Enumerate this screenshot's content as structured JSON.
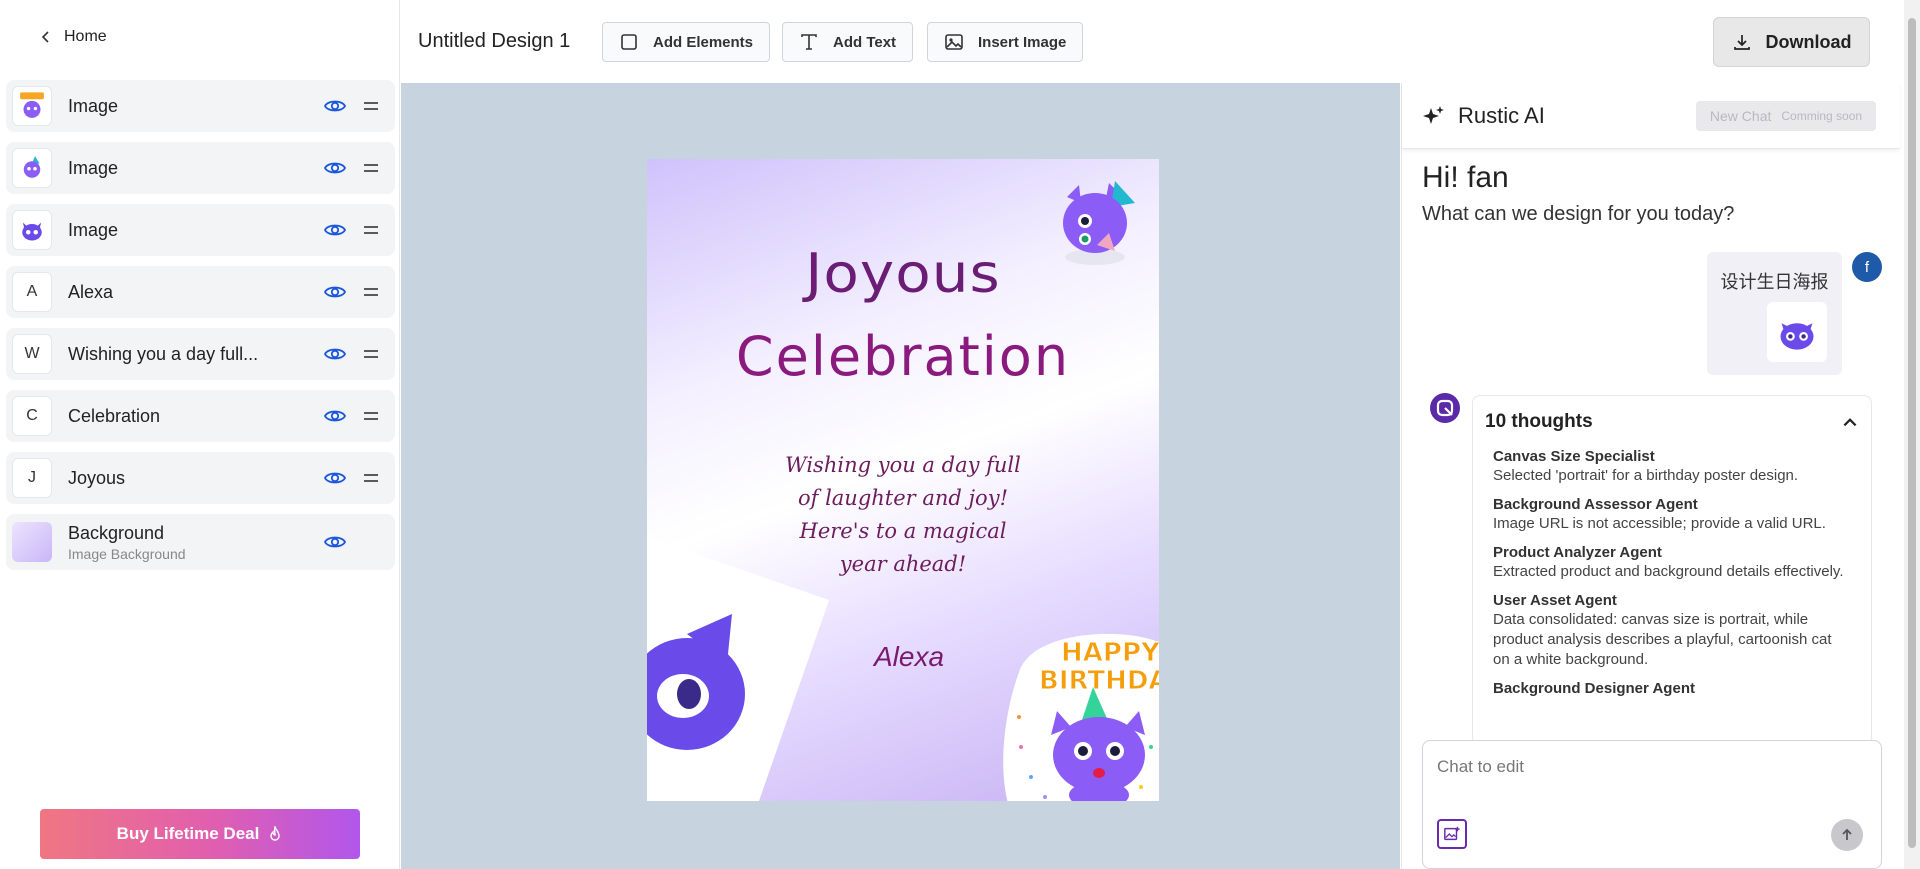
{
  "sidebar": {
    "home_label": "Home",
    "layers": [
      {
        "name": "Image",
        "thumb": "birthday-cat-thumb"
      },
      {
        "name": "Image",
        "thumb": "party-cat-thumb"
      },
      {
        "name": "Image",
        "thumb": "purple-cat-thumb"
      },
      {
        "name": "Alexa",
        "letter": "A"
      },
      {
        "name": "Wishing you a day full...",
        "letter": "W"
      },
      {
        "name": "Celebration",
        "letter": "C"
      },
      {
        "name": "Joyous",
        "letter": "J"
      },
      {
        "name": "Background",
        "sub": "Image Background"
      }
    ],
    "buy_label": "Buy Lifetime Deal"
  },
  "toolbar": {
    "title": "Untitled Design 1",
    "add_elements": "Add Elements",
    "add_text": "Add Text",
    "insert_image": "Insert Image",
    "download": "Download"
  },
  "poster": {
    "title_line1": "Joyous",
    "title_line2": "Celebration",
    "wish": "Wishing you a day full of laughter and joy! Here's to a magical year ahead!",
    "name": "Alexa",
    "sticker_text_1": "HAPPY",
    "sticker_text_2": "BIRTHDAY!"
  },
  "ai": {
    "title": "Rustic AI",
    "new_chat": "New Chat",
    "coming_soon": "Comming soon",
    "greeting": "Hi! fan",
    "subgreeting": "What can we design for you today?",
    "user_message": "设计生日海报",
    "user_initial": "f",
    "thoughts_title": "10 thoughts",
    "thoughts": [
      {
        "title": "Canvas Size Specialist",
        "desc": "Selected 'portrait' for a birthday poster design."
      },
      {
        "title": "Background Assessor Agent",
        "desc": "Image URL is not accessible; provide a valid URL."
      },
      {
        "title": "Product Analyzer Agent",
        "desc": "Extracted product and background details effectively."
      },
      {
        "title": "User Asset Agent",
        "desc": "Data consolidated: canvas size is portrait, while product analysis describes a playful, cartoonish cat on a white background."
      },
      {
        "title": "Background Designer Agent",
        "desc": ""
      }
    ],
    "chat_placeholder": "Chat to edit"
  },
  "colors": {
    "accent": "#1a56db",
    "buy_gradient_start": "#f07682",
    "buy_gradient_end": "#b157ec",
    "poster_title": "#6b1d76",
    "canvas_bg": "#c8d3e0"
  }
}
